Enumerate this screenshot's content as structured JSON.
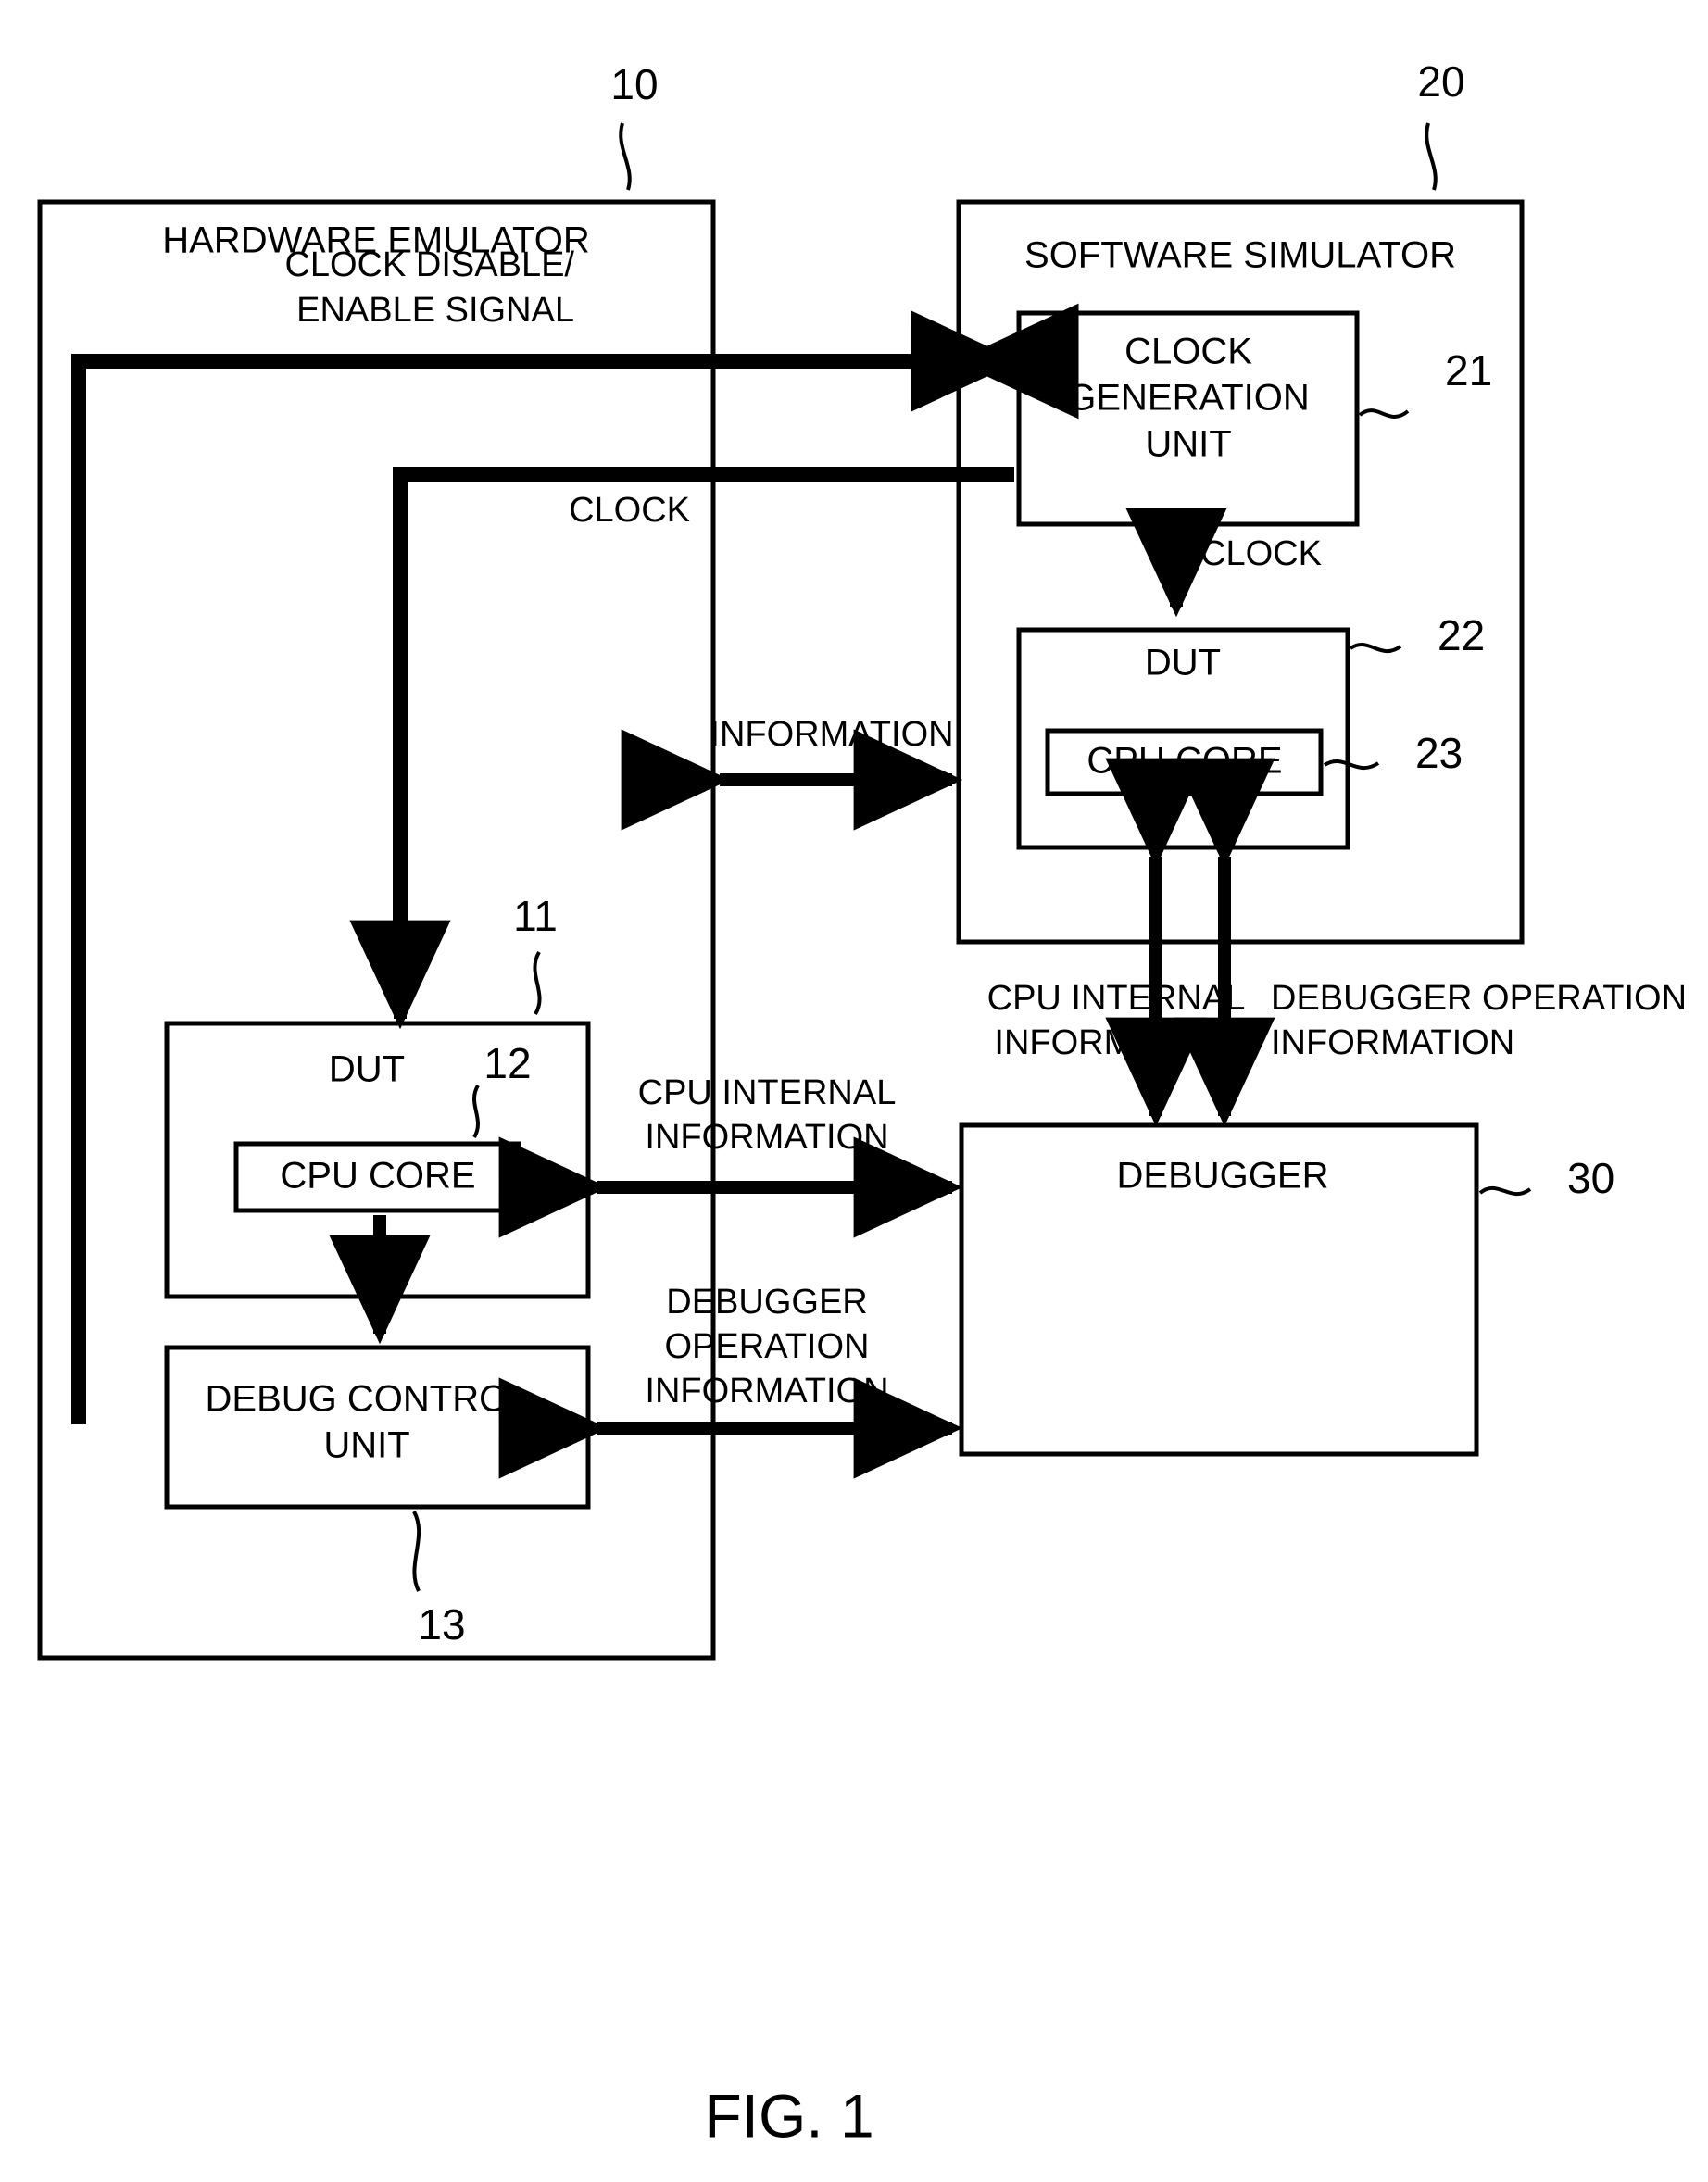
{
  "figure": {
    "caption": "FIG. 1",
    "type": "patent-block-diagram"
  },
  "blocks": {
    "hardware_emulator": {
      "title": "HARDWARE EMULATOR",
      "ref": "10"
    },
    "software_simulator": {
      "title": "SOFTWARE SIMULATOR",
      "ref": "20"
    },
    "clock_generation_unit": {
      "title_line1": "CLOCK",
      "title_line2": "GENERATION",
      "title_line3": "UNIT",
      "ref": "21"
    },
    "sim_dut": {
      "title": "DUT",
      "ref": "22"
    },
    "sim_cpu_core": {
      "title": "CPU CORE",
      "ref": "23"
    },
    "hw_dut": {
      "title": "DUT",
      "ref": "11"
    },
    "hw_cpu_core": {
      "title": "CPU CORE",
      "ref": "12"
    },
    "debug_control_unit": {
      "title_line1": "DEBUG CONTROL",
      "title_line2": "UNIT",
      "ref": "13"
    },
    "debugger": {
      "title": "DEBUGGER",
      "ref": "30"
    }
  },
  "signals": {
    "clock_disable_enable": {
      "line1": "CLOCK DISABLE/",
      "line2": "ENABLE SIGNAL"
    },
    "clock_to_emulator": {
      "label": "CLOCK"
    },
    "clock_to_sim_dut": {
      "label": "CLOCK"
    },
    "information": {
      "label": "INFORMATION"
    },
    "sim_cpu_internal_information": {
      "line1": "CPU INTERNAL",
      "line2": "INFORMATION"
    },
    "sim_debugger_operation_information": {
      "line1": "DEBUGGER OPERATION",
      "line2": "INFORMATION"
    },
    "hw_cpu_internal_information": {
      "line1": "CPU INTERNAL",
      "line2": "INFORMATION"
    },
    "hw_debugger_operation_information": {
      "line1": "DEBUGGER",
      "line2": "OPERATION",
      "line3": "INFORMATION"
    }
  },
  "colors": {
    "stroke": "#000000",
    "background": "#ffffff"
  }
}
